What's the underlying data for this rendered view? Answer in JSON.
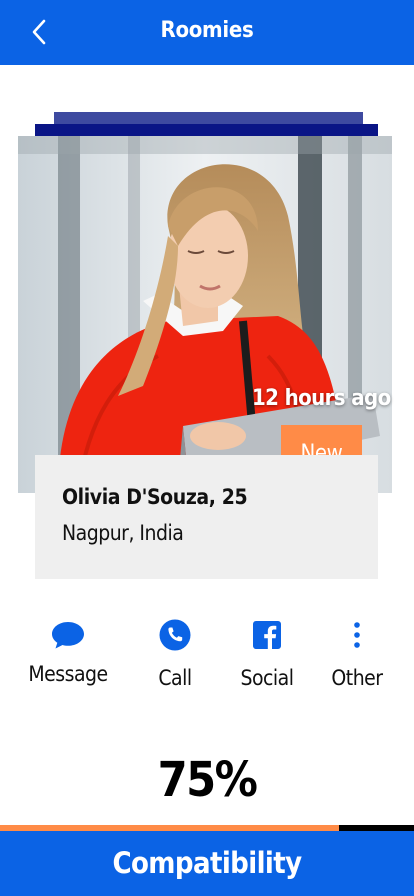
{
  "header": {
    "title": "Roomies",
    "back_icon": "chevron-left-icon"
  },
  "profile": {
    "posted": "12 hours ago",
    "badge": "New",
    "name_age": "Olivia D'Souza, 25",
    "location": "Nagpur, India"
  },
  "actions": [
    {
      "label": "Message",
      "icon": "chat-bubble-icon"
    },
    {
      "label": "Call",
      "icon": "phone-icon"
    },
    {
      "label": "Social",
      "icon": "facebook-icon"
    },
    {
      "label": "Other",
      "icon": "more-vertical-icon"
    }
  ],
  "compatibility": {
    "percent_label": "75%",
    "value": 0.82,
    "button_label": "Compatibility"
  },
  "colors": {
    "primary": "#0b63e5",
    "accent": "#ff8b47",
    "navy": "#0a1586"
  }
}
